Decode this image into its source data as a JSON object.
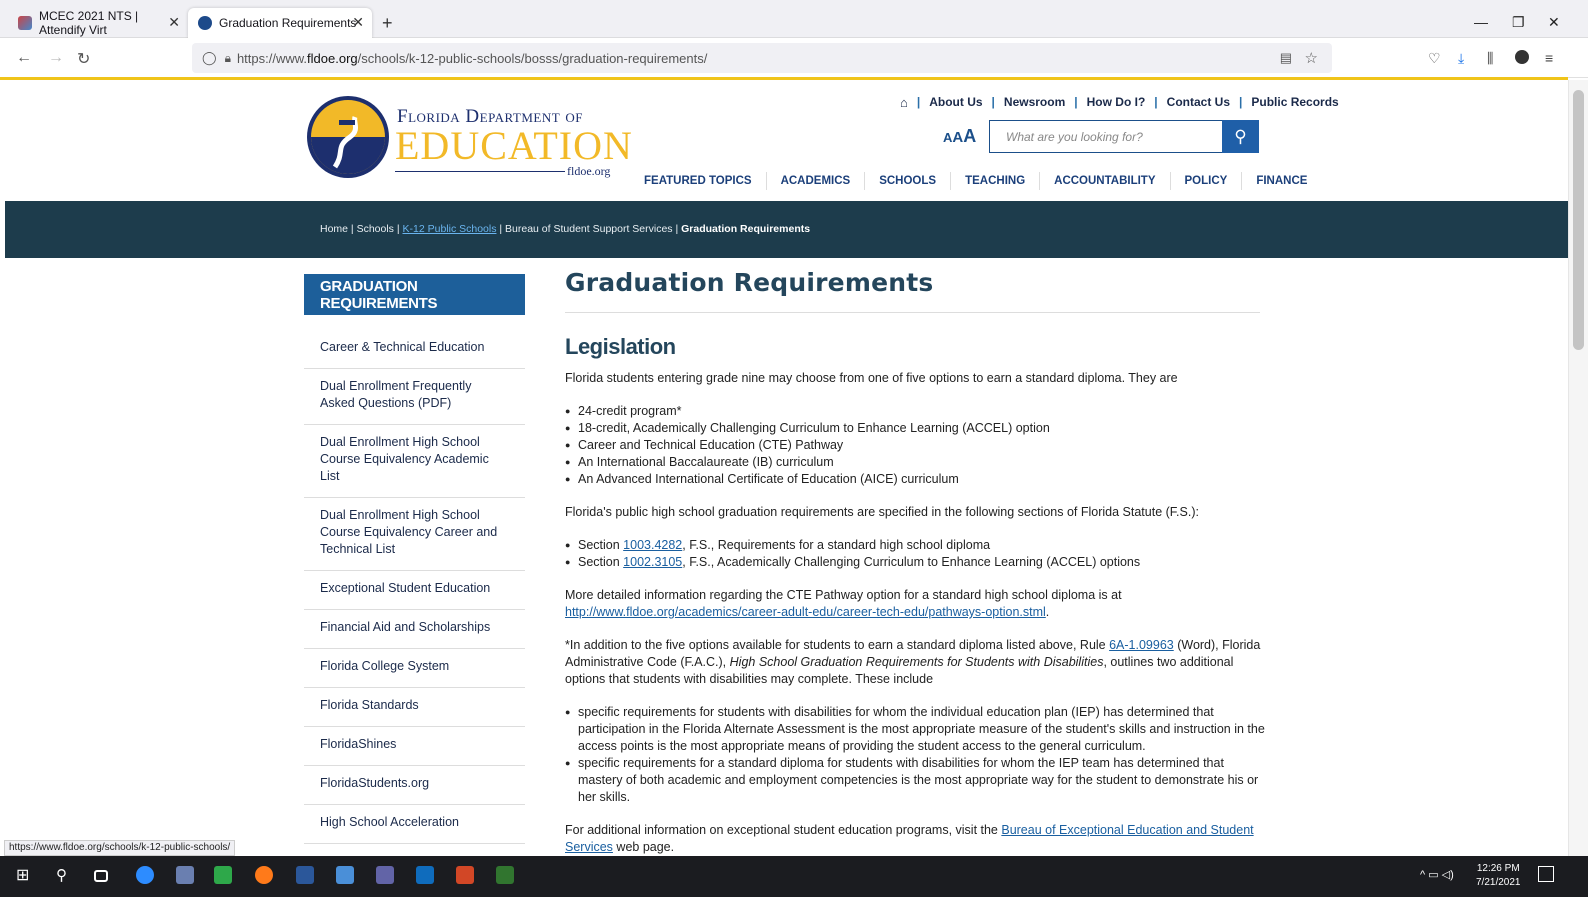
{
  "browser": {
    "tabs": [
      {
        "title": "MCEC 2021 NTS | Attendify Virt"
      },
      {
        "title": "Graduation Requirements"
      }
    ],
    "url_prefix": "https://www.",
    "url_domain": "fldoe.org",
    "url_path": "/schools/k-12-public-schools/bosss/graduation-requirements/",
    "status_url": "https://www.fldoe.org/schools/k-12-public-schools/"
  },
  "header": {
    "logo_line1": "Florida Department of",
    "logo_line2": "EDUCATION",
    "logo_domain": "fldoe.org",
    "top_links": [
      "About Us",
      "Newsroom",
      "How Do I?",
      "Contact Us",
      "Public Records"
    ],
    "text_size_label": "AAA",
    "search_placeholder": "What are you looking for?",
    "main_nav": [
      "FEATURED TOPICS",
      "ACADEMICS",
      "SCHOOLS",
      "TEACHING",
      "ACCOUNTABILITY",
      "POLICY",
      "FINANCE"
    ]
  },
  "breadcrumb": {
    "home": "Home",
    "schools": "Schools",
    "k12": "K-12 Public Schools",
    "bureau": "Bureau of Student Support Services",
    "current": "Graduation Requirements"
  },
  "sidebar": {
    "heading": "GRADUATION REQUIREMENTS",
    "items": [
      "Career & Technical Education",
      "Dual Enrollment Frequently Asked Questions (PDF)",
      "Dual Enrollment High School Course Equivalency Academic List",
      "Dual Enrollment High School Course Equivalency Career and Technical List",
      "Exceptional Student Education",
      "Financial Aid and Scholarships",
      "Florida College System",
      "Florida Standards",
      "FloridaShines",
      "FloridaStudents.org",
      "High School Acceleration"
    ]
  },
  "main": {
    "title": "Graduation Requirements",
    "section": "Legislation",
    "intro": "Florida students entering grade nine may choose from one of five options to earn a standard diploma. They are",
    "options": [
      "24-credit program*",
      "18-credit, Academically Challenging Curriculum to Enhance Learning (ACCEL) option",
      "Career and Technical Education (CTE) Pathway",
      "An International Baccalaureate (IB) curriculum",
      "An Advanced International Certificate of Education (AICE) curriculum"
    ],
    "statute_intro": "Florida's public high school graduation requirements are specified in the following sections of Florida Statute (F.S.):",
    "statute1_pre": "Section ",
    "statute1_link": "1003.4282",
    "statute1_post": ", F.S., Requirements for a standard high school diploma",
    "statute2_pre": "Section ",
    "statute2_link": "1002.3105",
    "statute2_post": ", F.S., Academically Challenging Curriculum to Enhance Learning (ACCEL) options",
    "cte_text": "More detailed information regarding the CTE Pathway option for a standard high school diploma is at ",
    "cte_link": "http://www.fldoe.org/academics/career-adult-edu/career-tech-edu/pathways-option.stml",
    "rule_pre": "*In addition to the five options available for students to earn a standard diploma listed above, Rule ",
    "rule_link": "6A-1.09963",
    "rule_mid": " (Word), Florida Administrative Code (F.A.C.), ",
    "rule_italic": "High School Graduation Requirements for Students with Disabilities",
    "rule_post": ", outlines two additional options that students with disabilities may complete. These include",
    "disab": [
      "specific requirements for students with disabilities for whom the individual education plan (IEP) has determined that participation in the Florida Alternate Assessment is the most appropriate measure of the student's skills and instruction in the access points is the most appropriate means of providing the student access to the general curriculum.",
      "specific requirements for a standard diploma for students with disabilities for whom the IEP team has determined that mastery of both academic and employment competencies is the most appropriate way for the student to demonstrate his or her skills."
    ],
    "ese_pre": "For additional information on exceptional student education programs, visit the ",
    "ese_link": "Bureau of Exceptional Education and Student Services",
    "ese_post": " web page."
  },
  "taskbar": {
    "time": "12:26 PM",
    "date": "7/21/2021"
  },
  "colors": {
    "brand_navy": "#24465c",
    "breadcrumb_band": "#1d3c4c",
    "sidebar_head": "#1d5f9a",
    "link_blue": "#1a5fa0",
    "accent_yellow": "#f0c419"
  }
}
